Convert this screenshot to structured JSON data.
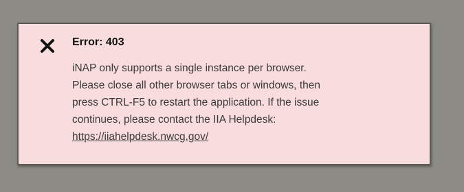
{
  "error": {
    "title": "Error: 403",
    "message_lines": [
      "iNAP only supports a single instance per browser.",
      "Please close all other browser tabs or windows, then",
      "press CTRL-F5 to restart the application. If the issue",
      "continues, please contact the IIA Helpdesk:"
    ],
    "link_text": "https://iiahelpdesk.nwcg.gov/",
    "close_icon": "close-icon"
  },
  "colors": {
    "backdrop": "#8c8a85",
    "panel_background": "#f9dcdd",
    "panel_border": "#5d5a58",
    "text": "#3a3a3a",
    "title": "#111111"
  }
}
